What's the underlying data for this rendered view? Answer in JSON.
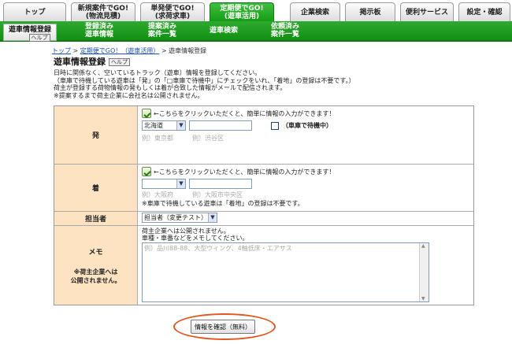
{
  "tabs": [
    {
      "label": "トップ"
    },
    {
      "label": "新規案件でGO!\n(物流見積)"
    },
    {
      "label": "単発便でGO!\n(求荷求車)"
    },
    {
      "label": "定期便でGO!\n(遊車活用)"
    },
    {
      "label": "企業検索"
    },
    {
      "label": "掲示板"
    },
    {
      "label": "便利サービス"
    },
    {
      "label": "設定・確認"
    }
  ],
  "subnav": {
    "items": [
      {
        "label": "遊車情報登録"
      },
      {
        "label": "登録済み\n遊車情報"
      },
      {
        "label": "提案済み\n案件一覧"
      },
      {
        "label": "遊車検索"
      },
      {
        "label": "依頼済み\n案件一覧"
      }
    ],
    "help_label": "ヘルプ"
  },
  "breadcrumb": {
    "top": "トップ",
    "sep1": " > ",
    "section": "定期便でGO！（遊車活用）",
    "sep2": " > ",
    "current": "遊車情報登録"
  },
  "page": {
    "title": "遊車情報登録",
    "help_label": "ヘルプ",
    "desc1": "日時に関係なく、空いているトラック（遊車）情報を登録してください。",
    "desc2": "（車庫で待機している遊車は「発」の「□車庫で待機中」にチェックをいれ、「着地」の登録は不要です。）",
    "desc3": "荷主が登録する荷物情報の発もしくは着が合致した情報がメールで配信されます。",
    "desc4": "※提案するまで荷主企業に会社名は公開されません。"
  },
  "form": {
    "hint": "←こちらをクリックいただくと、簡単に情報の入力ができます！",
    "departure": {
      "label": "発",
      "prefecture": "北海道",
      "ph_city": "例）東京都",
      "ph_ward": "例）渋谷区",
      "waiting_label": "（車庫で待機中）"
    },
    "arrival": {
      "label": "着",
      "prefecture": "",
      "ph_city": "例）大阪府",
      "ph_ward": "例）大阪市中央区",
      "note": "※車庫で待機している遊車は「着地」の登録は不要です。"
    },
    "staff": {
      "label": "担当者",
      "value": "担当者（変更テスト）"
    },
    "memo": {
      "label": "メモ",
      "label_note1": "※荷主企業へは",
      "label_note2": "公開されません。",
      "text1": "荷主企業へは公開されません。",
      "text2": "車種・車番などをメモしてください。",
      "placeholder": "例）品川88-88、大型ウィング、4軸低床・エアサス"
    }
  },
  "confirm": {
    "label": "情報を確認（無料）"
  },
  "colors": {
    "accent_green": "#169c16",
    "label_bg": "#fde3c2",
    "highlight_ring": "#e7551f"
  }
}
